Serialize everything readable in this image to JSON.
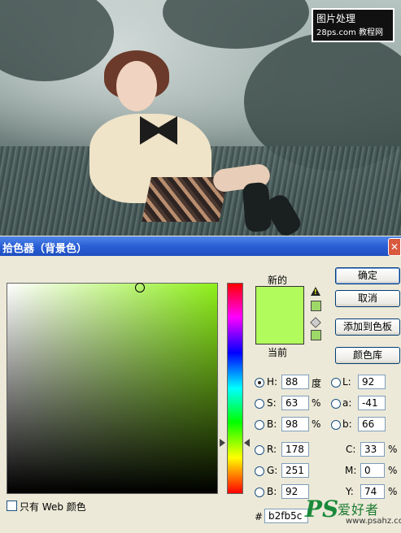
{
  "photo": {
    "watermark_line1": "图片处理",
    "watermark_line2": "28ps.com",
    "watermark_line3": "教程网"
  },
  "dialog": {
    "title": "拾色器（背景色）",
    "close_label": "✕",
    "label_new": "新的",
    "label_current": "当前",
    "new_color": "#b2fb5c",
    "current_color": "#b2fb5c",
    "warn_mini_color": "#9ed868",
    "cube_mini_color": "#9ed868",
    "buttons": {
      "ok": "确定",
      "cancel": "取消",
      "add_swatch": "添加到色板",
      "color_library": "颜色库"
    },
    "hsb": {
      "h": {
        "label": "H:",
        "value": "88",
        "unit": "度"
      },
      "s": {
        "label": "S:",
        "value": "63",
        "unit": "%"
      },
      "b": {
        "label": "B:",
        "value": "98",
        "unit": "%"
      }
    },
    "rgb": {
      "r": {
        "label": "R:",
        "value": "178"
      },
      "g": {
        "label": "G:",
        "value": "251"
      },
      "b": {
        "label": "B:",
        "value": "92"
      }
    },
    "lab": {
      "l": {
        "label": "L:",
        "value": "92"
      },
      "a": {
        "label": "a:",
        "value": "-41"
      },
      "b": {
        "label": "b:",
        "value": "66"
      }
    },
    "cmyk": {
      "c": {
        "label": "C:",
        "value": "33",
        "unit": "%"
      },
      "m": {
        "label": "M:",
        "value": "0",
        "unit": "%"
      },
      "y": {
        "label": "Y:",
        "value": "74",
        "unit": "%"
      }
    },
    "hex_prefix": "#",
    "hex_value": "b2fb5c",
    "web_only_label": "只有 Web 颜色"
  },
  "logo": {
    "ps": "PS",
    "cn": "爱好者",
    "url": "www.psahz.com"
  }
}
